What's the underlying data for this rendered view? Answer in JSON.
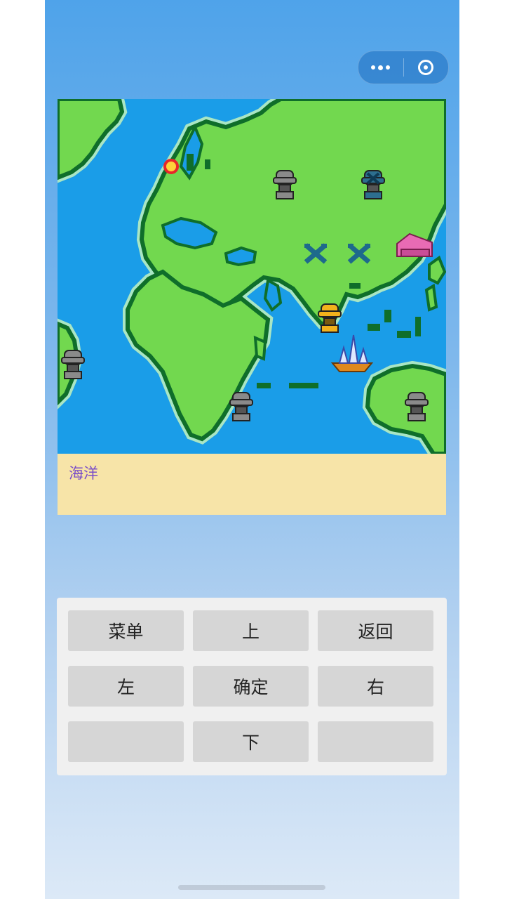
{
  "capsule": {
    "more_icon": "more-dots-icon",
    "close_icon": "target-close-icon"
  },
  "map": {
    "colors": {
      "ocean": "#1a9de8",
      "land": "#72d84f",
      "coast": "#0f6e2a",
      "border": "#a9e6c4"
    },
    "markers": [
      {
        "name": "red-ring-marker-icon",
        "kind": "ring"
      },
      {
        "name": "grey-statue-icon-1",
        "kind": "statue"
      },
      {
        "name": "blue-statue-icon",
        "kind": "bluestatue"
      },
      {
        "name": "blue-cross-icon-1",
        "kind": "cross"
      },
      {
        "name": "blue-cross-icon-2",
        "kind": "cross"
      },
      {
        "name": "pink-house-icon",
        "kind": "house"
      },
      {
        "name": "gold-statue-icon",
        "kind": "gold"
      },
      {
        "name": "player-ship-icon",
        "kind": "ship"
      },
      {
        "name": "grey-statue-icon-2",
        "kind": "statue"
      },
      {
        "name": "grey-statue-icon-3",
        "kind": "statue"
      },
      {
        "name": "grey-statue-icon-4",
        "kind": "statue"
      }
    ]
  },
  "message": {
    "text": "海洋"
  },
  "controls": {
    "menu": "菜单",
    "up": "上",
    "back": "返回",
    "left": "左",
    "confirm": "确定",
    "right": "右",
    "blank_left": "",
    "down": "下",
    "blank_right": ""
  }
}
